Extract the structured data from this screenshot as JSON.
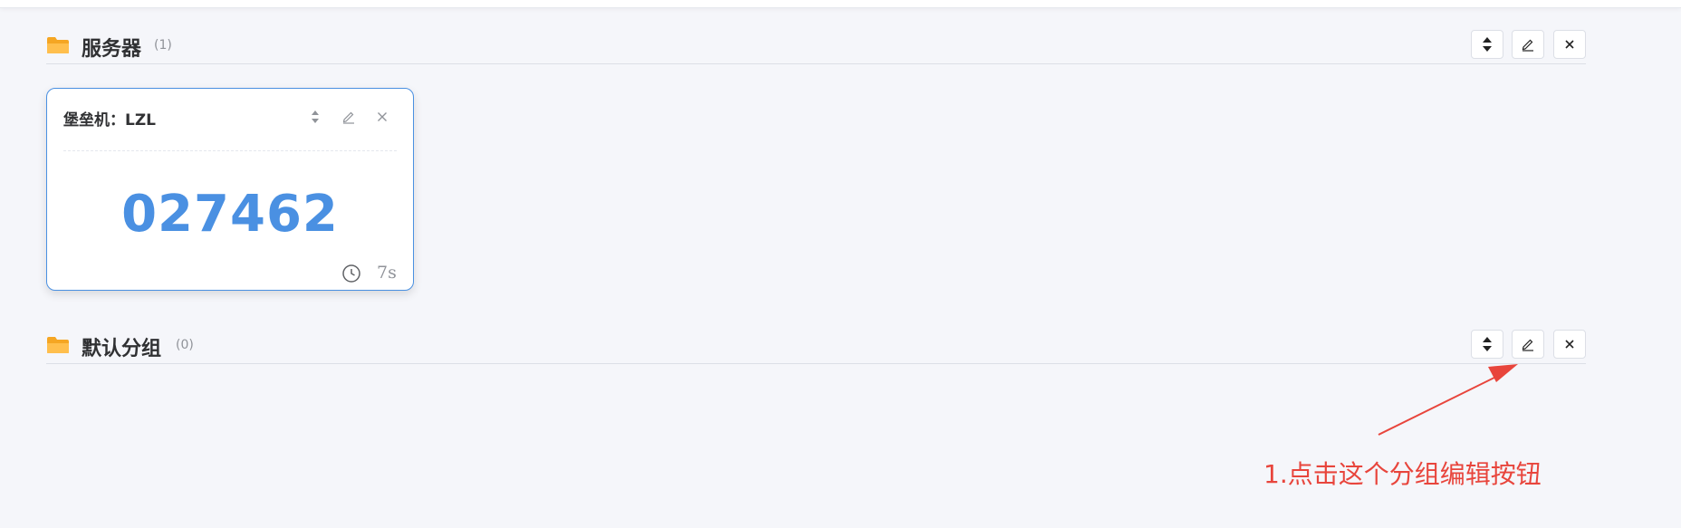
{
  "groups": [
    {
      "name": "服务器",
      "count": "(1)"
    },
    {
      "name": "默认分组",
      "count": "(0)"
    }
  ],
  "card": {
    "title": "堡垒机：LZL",
    "code": "027462",
    "timer": "7s"
  },
  "annotation": {
    "text": "1.点击这个分组编辑按钮",
    "color": "#e8453c"
  },
  "colors": {
    "accent": "#4a90e2",
    "folder": "#f5a623",
    "background": "#f5f6fa"
  },
  "icons": {
    "folder": "folder-icon",
    "sort": "sort-icon",
    "edit": "edit-icon",
    "close": "close-icon",
    "clock": "clock-icon"
  }
}
